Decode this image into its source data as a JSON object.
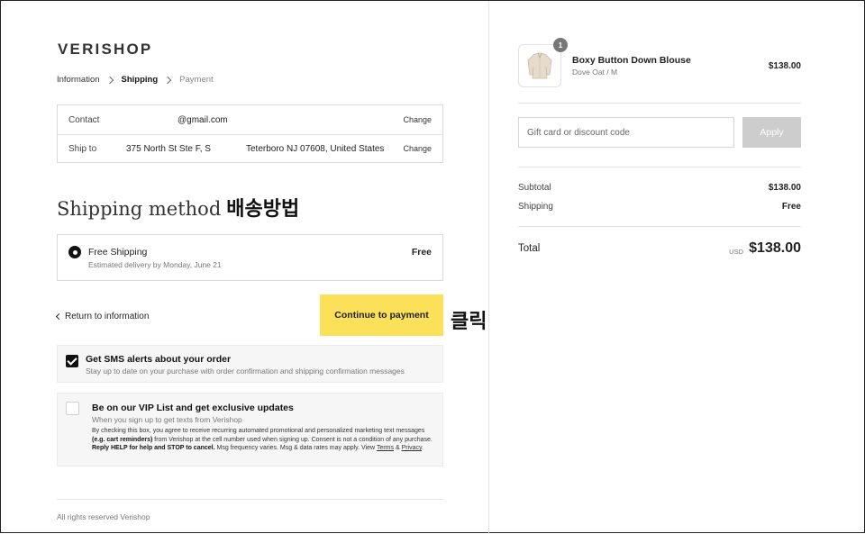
{
  "brand": {
    "logo": "VERISHOP"
  },
  "breadcrumb": {
    "step1": "Information",
    "step2": "Shipping",
    "step3": "Payment"
  },
  "review": {
    "contact_label": "Contact",
    "contact_value": "@gmail.com",
    "shipto_label": "Ship to",
    "shipto_value": "375 North St Ste F, S",
    "shipto_value2": "Teterboro NJ 07608, United States",
    "change_label": "Change"
  },
  "shipping": {
    "heading": "Shipping method",
    "heading_annotation": "배송방법",
    "method_name": "Free Shipping",
    "method_sub": "Estimated delivery by Monday, June 21",
    "method_price": "Free"
  },
  "actions": {
    "return_label": "Return to information",
    "continue_label": "Continue to payment",
    "continue_annotation": "클릭"
  },
  "sms": {
    "title": "Get SMS alerts about your order",
    "sub": "Stay up to date on your purchase with order confirmation and shipping confirmation messages",
    "checked": true
  },
  "vip": {
    "title": "Be on our VIP List and get exclusive updates",
    "sub": "When you sign up to get texts from Verishop",
    "legal_1": "By checking this box, you agree to receive recurring automated promotional and personalized marketing text messages",
    "legal_2": "(e.g. cart reminders)",
    "legal_3": "from Verishop at the cell number used when signing up. Consent is not a condition of any purchase.",
    "legal_4": "Reply HELP for help and STOP to cancel.",
    "legal_5": "Msg frequency varies. Msg & data rates may apply. View",
    "terms": "Terms",
    "amp": "&",
    "privacy": "Privacy",
    "period": ".",
    "checked": false
  },
  "footer": {
    "text": "All rights reserved Verishop"
  },
  "cart": {
    "qty": "1",
    "product_name": "Boxy Button Down Blouse",
    "product_variant": "Dove Oat / M",
    "product_price": "$138.00",
    "gift_placeholder": "Gift card or discount code",
    "apply_label": "Apply",
    "subtotal_label": "Subtotal",
    "subtotal_value": "$138.00",
    "shipping_label": "Shipping",
    "shipping_value": "Free",
    "total_label": "Total",
    "currency": "USD",
    "total_value": "$138.00"
  },
  "colors": {
    "accent": "#fbe05a",
    "apply_disabled": "#cdcdcd",
    "text": "#1a1a1a"
  }
}
